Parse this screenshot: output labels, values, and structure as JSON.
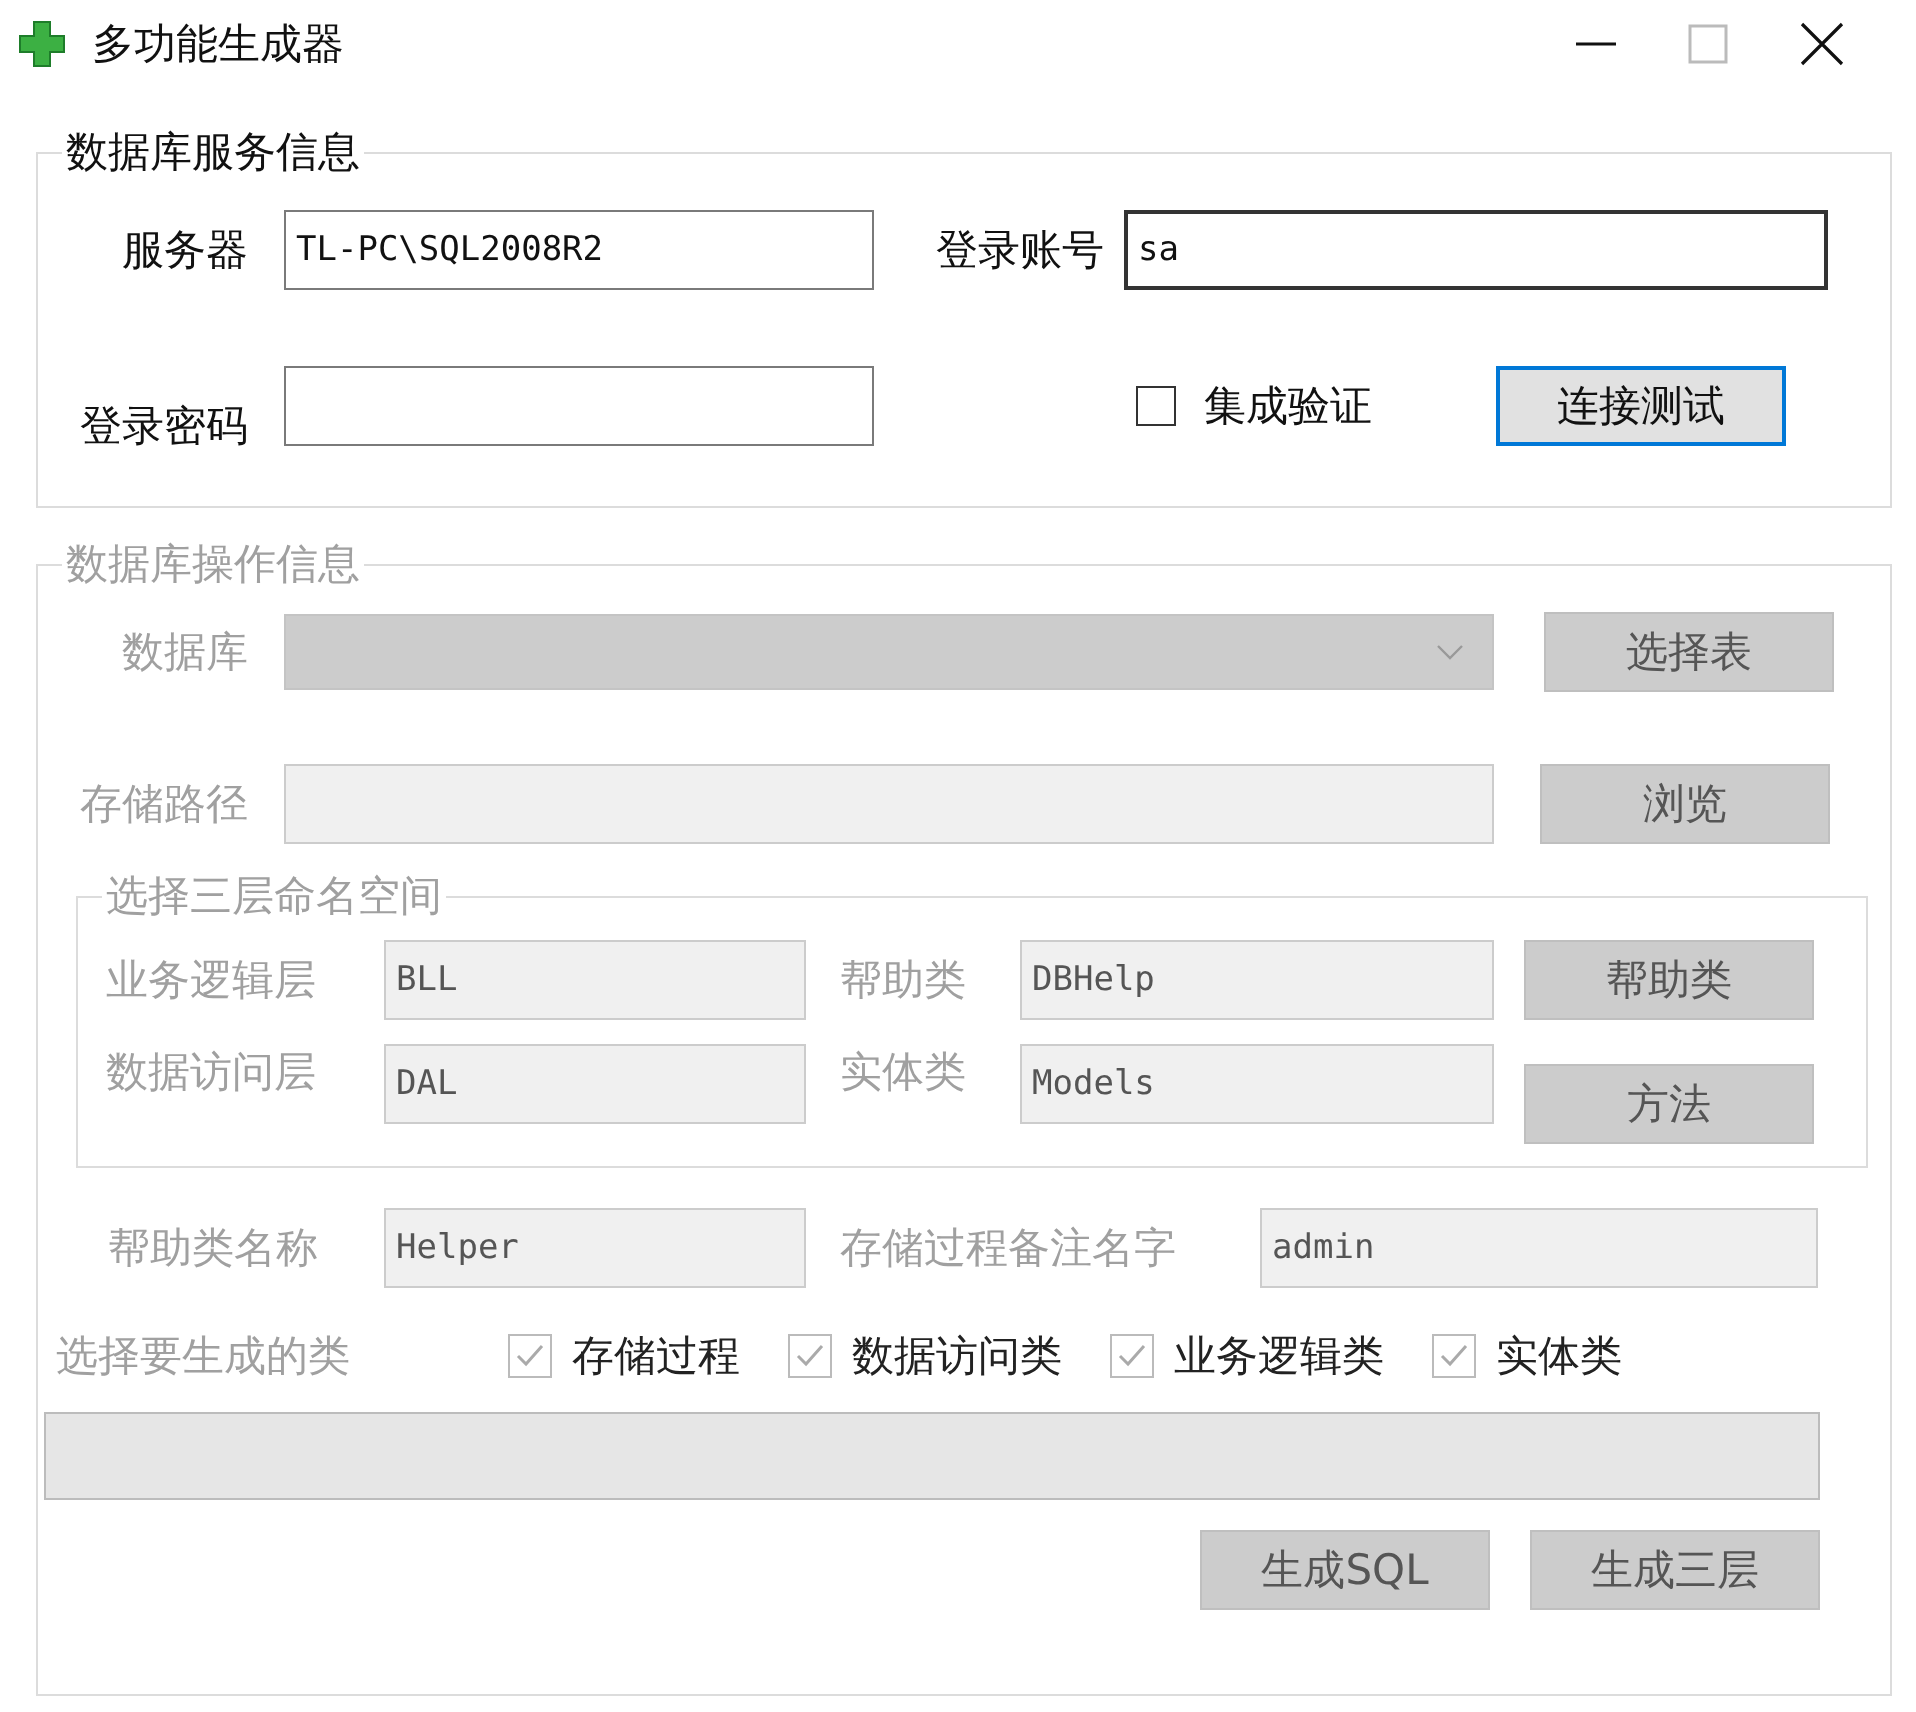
{
  "window": {
    "title": "多功能生成器"
  },
  "server_info": {
    "title": "数据库服务信息",
    "disabled": false,
    "server": {
      "label": "服务器",
      "value": "TL-PC\\SQL2008R2",
      "focused": false
    },
    "account": {
      "label": "登录账号",
      "value": "sa",
      "focused": true
    },
    "password": {
      "label": "登录密码"
    },
    "integrated_auth": {
      "label": "集成验证",
      "checked": false
    },
    "test_button": {
      "label": "连接测试",
      "default": true
    }
  },
  "operation_info": {
    "title": "数据库操作信息",
    "disabled": true,
    "database": {
      "label": "数据库"
    },
    "select_table_button": "选择表",
    "save_path": {
      "label": "存储路径"
    },
    "browse_button": "浏览",
    "namespace": {
      "title": "选择三层命名空间",
      "fields": [
        {
          "label": "业务逻辑层",
          "value": "BLL"
        },
        {
          "label": "帮助类",
          "value": "DBHelp"
        },
        {
          "label": "数据访问层",
          "value": "DAL"
        },
        {
          "label": "实体类",
          "value": "Models"
        }
      ],
      "buttons": [
        "帮助类",
        "方法"
      ]
    },
    "helper_name": {
      "label": "帮助类名称",
      "value": "Helper"
    },
    "proc_comment_name": {
      "label": "存储过程备注名字",
      "value": "admin"
    },
    "generate": {
      "label": "选择要生成的类",
      "options": [
        {
          "label": "存储过程",
          "checked": true
        },
        {
          "label": "数据访问类",
          "checked": true
        },
        {
          "label": "业务逻辑类",
          "checked": true
        },
        {
          "label": "实体类",
          "checked": true
        }
      ]
    },
    "progress": {
      "level": 0
    },
    "buttons": [
      "生成SQL",
      "生成三层"
    ]
  }
}
